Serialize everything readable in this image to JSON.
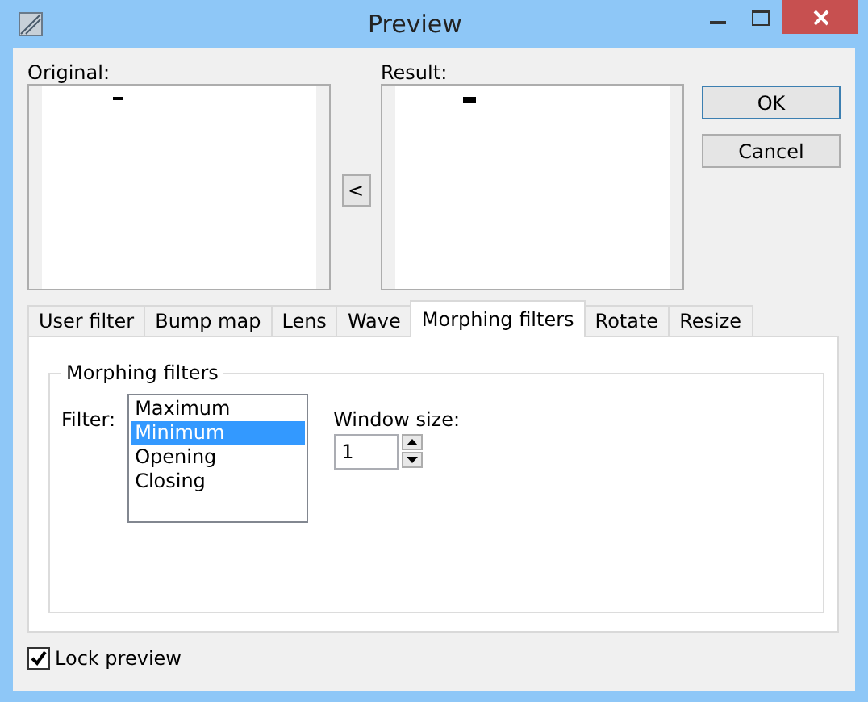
{
  "window": {
    "title": "Preview"
  },
  "original": {
    "label": "Original:"
  },
  "result": {
    "label": "Result:"
  },
  "copy_button": "<",
  "buttons": [
    "OK",
    "Cancel"
  ],
  "tabs": [
    {
      "label": "User filter",
      "selected": false
    },
    {
      "label": "Bump map",
      "selected": false
    },
    {
      "label": "Lens",
      "selected": false
    },
    {
      "label": "Wave",
      "selected": false
    },
    {
      "label": "Morphing filters",
      "selected": true
    },
    {
      "label": "Rotate",
      "selected": false
    },
    {
      "label": "Resize",
      "selected": false
    }
  ],
  "group": {
    "title": "Morphing filters",
    "filter_label": "Filter:",
    "filters": [
      {
        "label": "Maximum",
        "selected": false
      },
      {
        "label": "Minimum",
        "selected": true
      },
      {
        "label": "Opening",
        "selected": false
      },
      {
        "label": "Closing",
        "selected": false
      }
    ],
    "window_size_label": "Window size:",
    "window_size": "1"
  },
  "lock_preview": {
    "label": "Lock preview",
    "checked": true
  }
}
